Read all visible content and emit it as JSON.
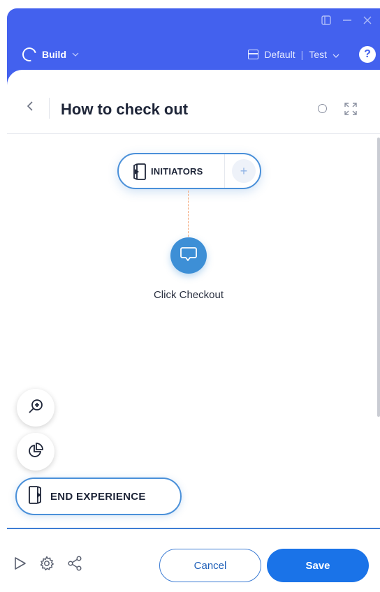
{
  "titlebar": {
    "controls": [
      "sidebar-toggle-icon",
      "minimize-icon",
      "close-icon"
    ]
  },
  "topbar": {
    "mode_label": "Build",
    "environment_label": "Default",
    "separator": "|",
    "test_label": "Test",
    "help_label": "?"
  },
  "header": {
    "back_glyph": "<",
    "title": "How to check out"
  },
  "canvas": {
    "initiators_label": "INITIATORS",
    "add_glyph": "+",
    "step_label": "Click Checkout",
    "end_label": "END EXPERIENCE"
  },
  "footer": {
    "cancel_label": "Cancel",
    "save_label": "Save"
  },
  "colors": {
    "brand_blue": "#4361ee",
    "node_blue": "#3d8fd6",
    "save_blue": "#1a73e8",
    "connector_orange": "#f5a87a"
  }
}
